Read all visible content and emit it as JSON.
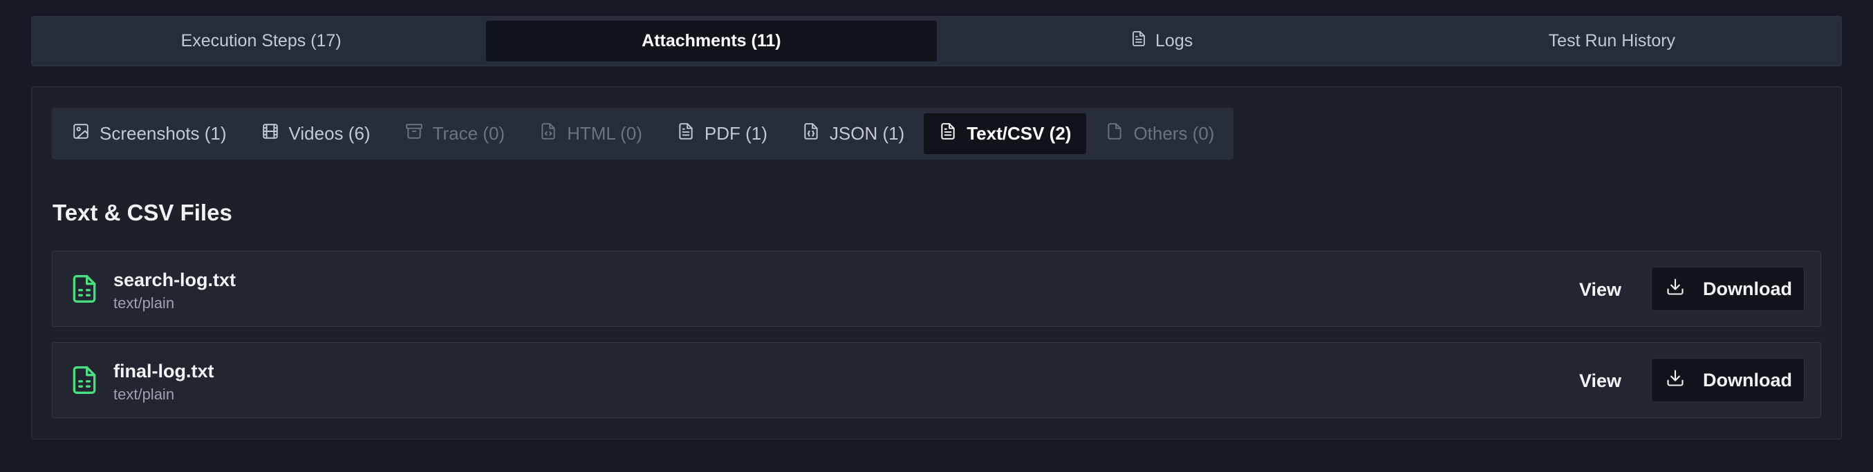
{
  "main_tabs": [
    {
      "label": "Execution Steps (17)",
      "active": false,
      "icon": ""
    },
    {
      "label": "Attachments (11)",
      "active": true,
      "icon": ""
    },
    {
      "label": "Logs",
      "active": false,
      "icon": "file-text-icon"
    },
    {
      "label": "Test Run History",
      "active": false,
      "icon": ""
    }
  ],
  "sub_tabs": [
    {
      "label": "Screenshots (1)",
      "icon": "image-icon",
      "state": "enabled"
    },
    {
      "label": "Videos (6)",
      "icon": "film-icon",
      "state": "enabled"
    },
    {
      "label": "Trace (0)",
      "icon": "archive-icon",
      "state": "disabled"
    },
    {
      "label": "HTML (0)",
      "icon": "file-code-icon",
      "state": "disabled"
    },
    {
      "label": "PDF (1)",
      "icon": "file-text-icon",
      "state": "enabled"
    },
    {
      "label": "JSON (1)",
      "icon": "file-json-icon",
      "state": "enabled"
    },
    {
      "label": "Text/CSV (2)",
      "icon": "file-text-icon",
      "state": "active"
    },
    {
      "label": "Others (0)",
      "icon": "file-icon",
      "state": "disabled"
    }
  ],
  "section": {
    "title": "Text & CSV Files"
  },
  "files": [
    {
      "name": "search-log.txt",
      "type": "text/plain",
      "icon": "file-spreadsheet-icon",
      "view_label": "View",
      "download_label": "Download"
    },
    {
      "name": "final-log.txt",
      "type": "text/plain",
      "icon": "file-spreadsheet-icon",
      "view_label": "View",
      "download_label": "Download"
    }
  ],
  "colors": {
    "accent_green": "#4ade80",
    "background": "#161a24",
    "active_tab": "#11131b"
  }
}
